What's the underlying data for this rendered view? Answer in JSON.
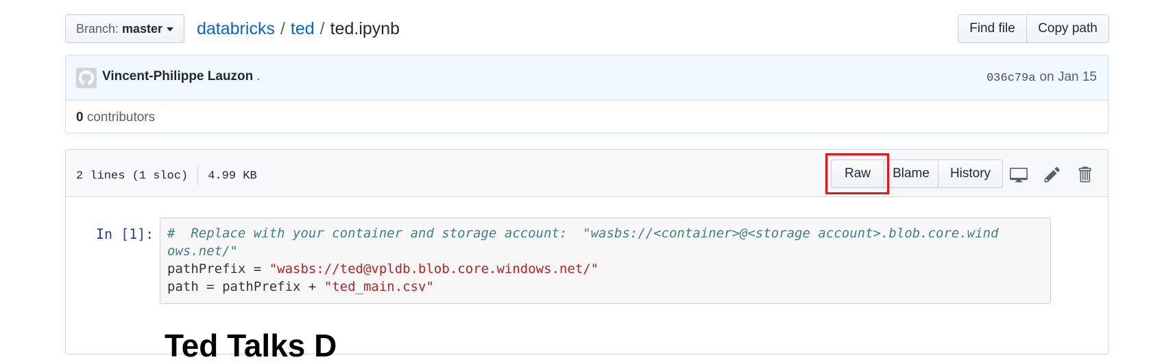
{
  "breadcrumb": {
    "branch_label": "Branch:",
    "branch_value": "master",
    "repo_owner": "databricks",
    "folder": "ted",
    "separator": "/",
    "file": "ted.ipynb"
  },
  "header_actions": {
    "find_file": "Find file",
    "copy_path": "Copy path"
  },
  "commit": {
    "author": "Vincent-Philippe Lauzon",
    "author_suffix": ".",
    "sha": "036c79a",
    "date": "on Jan 15",
    "contributors_count": "0",
    "contributors_label": "contributors"
  },
  "file": {
    "lines": "2 lines (1 sloc)",
    "size": "4.99 KB",
    "raw": "Raw",
    "blame": "Blame",
    "history": "History"
  },
  "notebook": {
    "prompt": "In [1]:",
    "line1_comment": "#  Replace with your container and storage account:  \"wasbs://<container>@<storage account>.blob.core.wind",
    "line2_comment": "ows.net/\"",
    "line3_code": "pathPrefix = ",
    "line3_string": "\"wasbs://ted@vpldb.blob.core.windows.net/\"",
    "line4_code": "path = pathPrefix + ",
    "line4_string": "\"ted_main.csv\"",
    "heading_partial": "Ted Talks D"
  },
  "colors": {
    "link": "#0366d6",
    "highlight_border": "#e8141c",
    "commit_bg": "#f1f8ff"
  },
  "icons": [
    "caret-down-icon",
    "octocat-avatar-icon",
    "desktop-icon",
    "pencil-icon",
    "trash-icon"
  ]
}
